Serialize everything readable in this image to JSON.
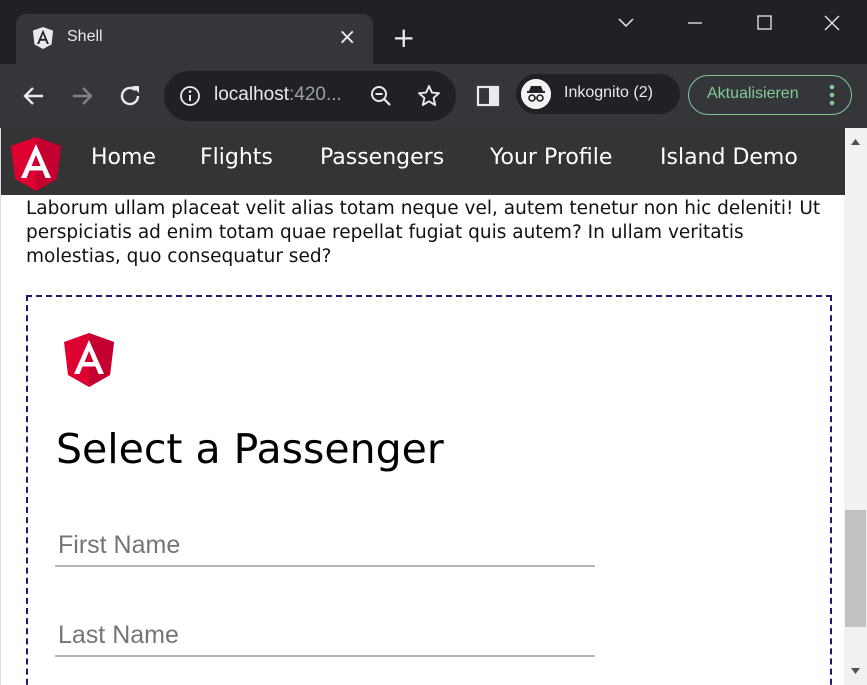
{
  "browser": {
    "tab_title": "Shell",
    "tab_close": "×",
    "new_tab": "+",
    "url_host": "localhost",
    "url_rest": ":420...",
    "profile_label": "Inkognito (2)",
    "update_label": "Aktualisieren",
    "accent_update": "#81c995"
  },
  "nav": {
    "links": [
      "Home",
      "Flights",
      "Passengers",
      "Your Profile",
      "Island Demo"
    ],
    "brand_color": "#dd0031",
    "background": "#343434"
  },
  "content": {
    "paragraph_cut": "Laborum ullam placeat velit alias totam neque vel, autem tenetur non hic deleniti! Ut perspiciatis ad enim totam quae repellat fugiat quis autem? In ullam veritatis molestias, quo consequatur sed?"
  },
  "island": {
    "title": "Select a Passenger",
    "first_name_placeholder": "First Name",
    "last_name_placeholder": "Last Name"
  }
}
